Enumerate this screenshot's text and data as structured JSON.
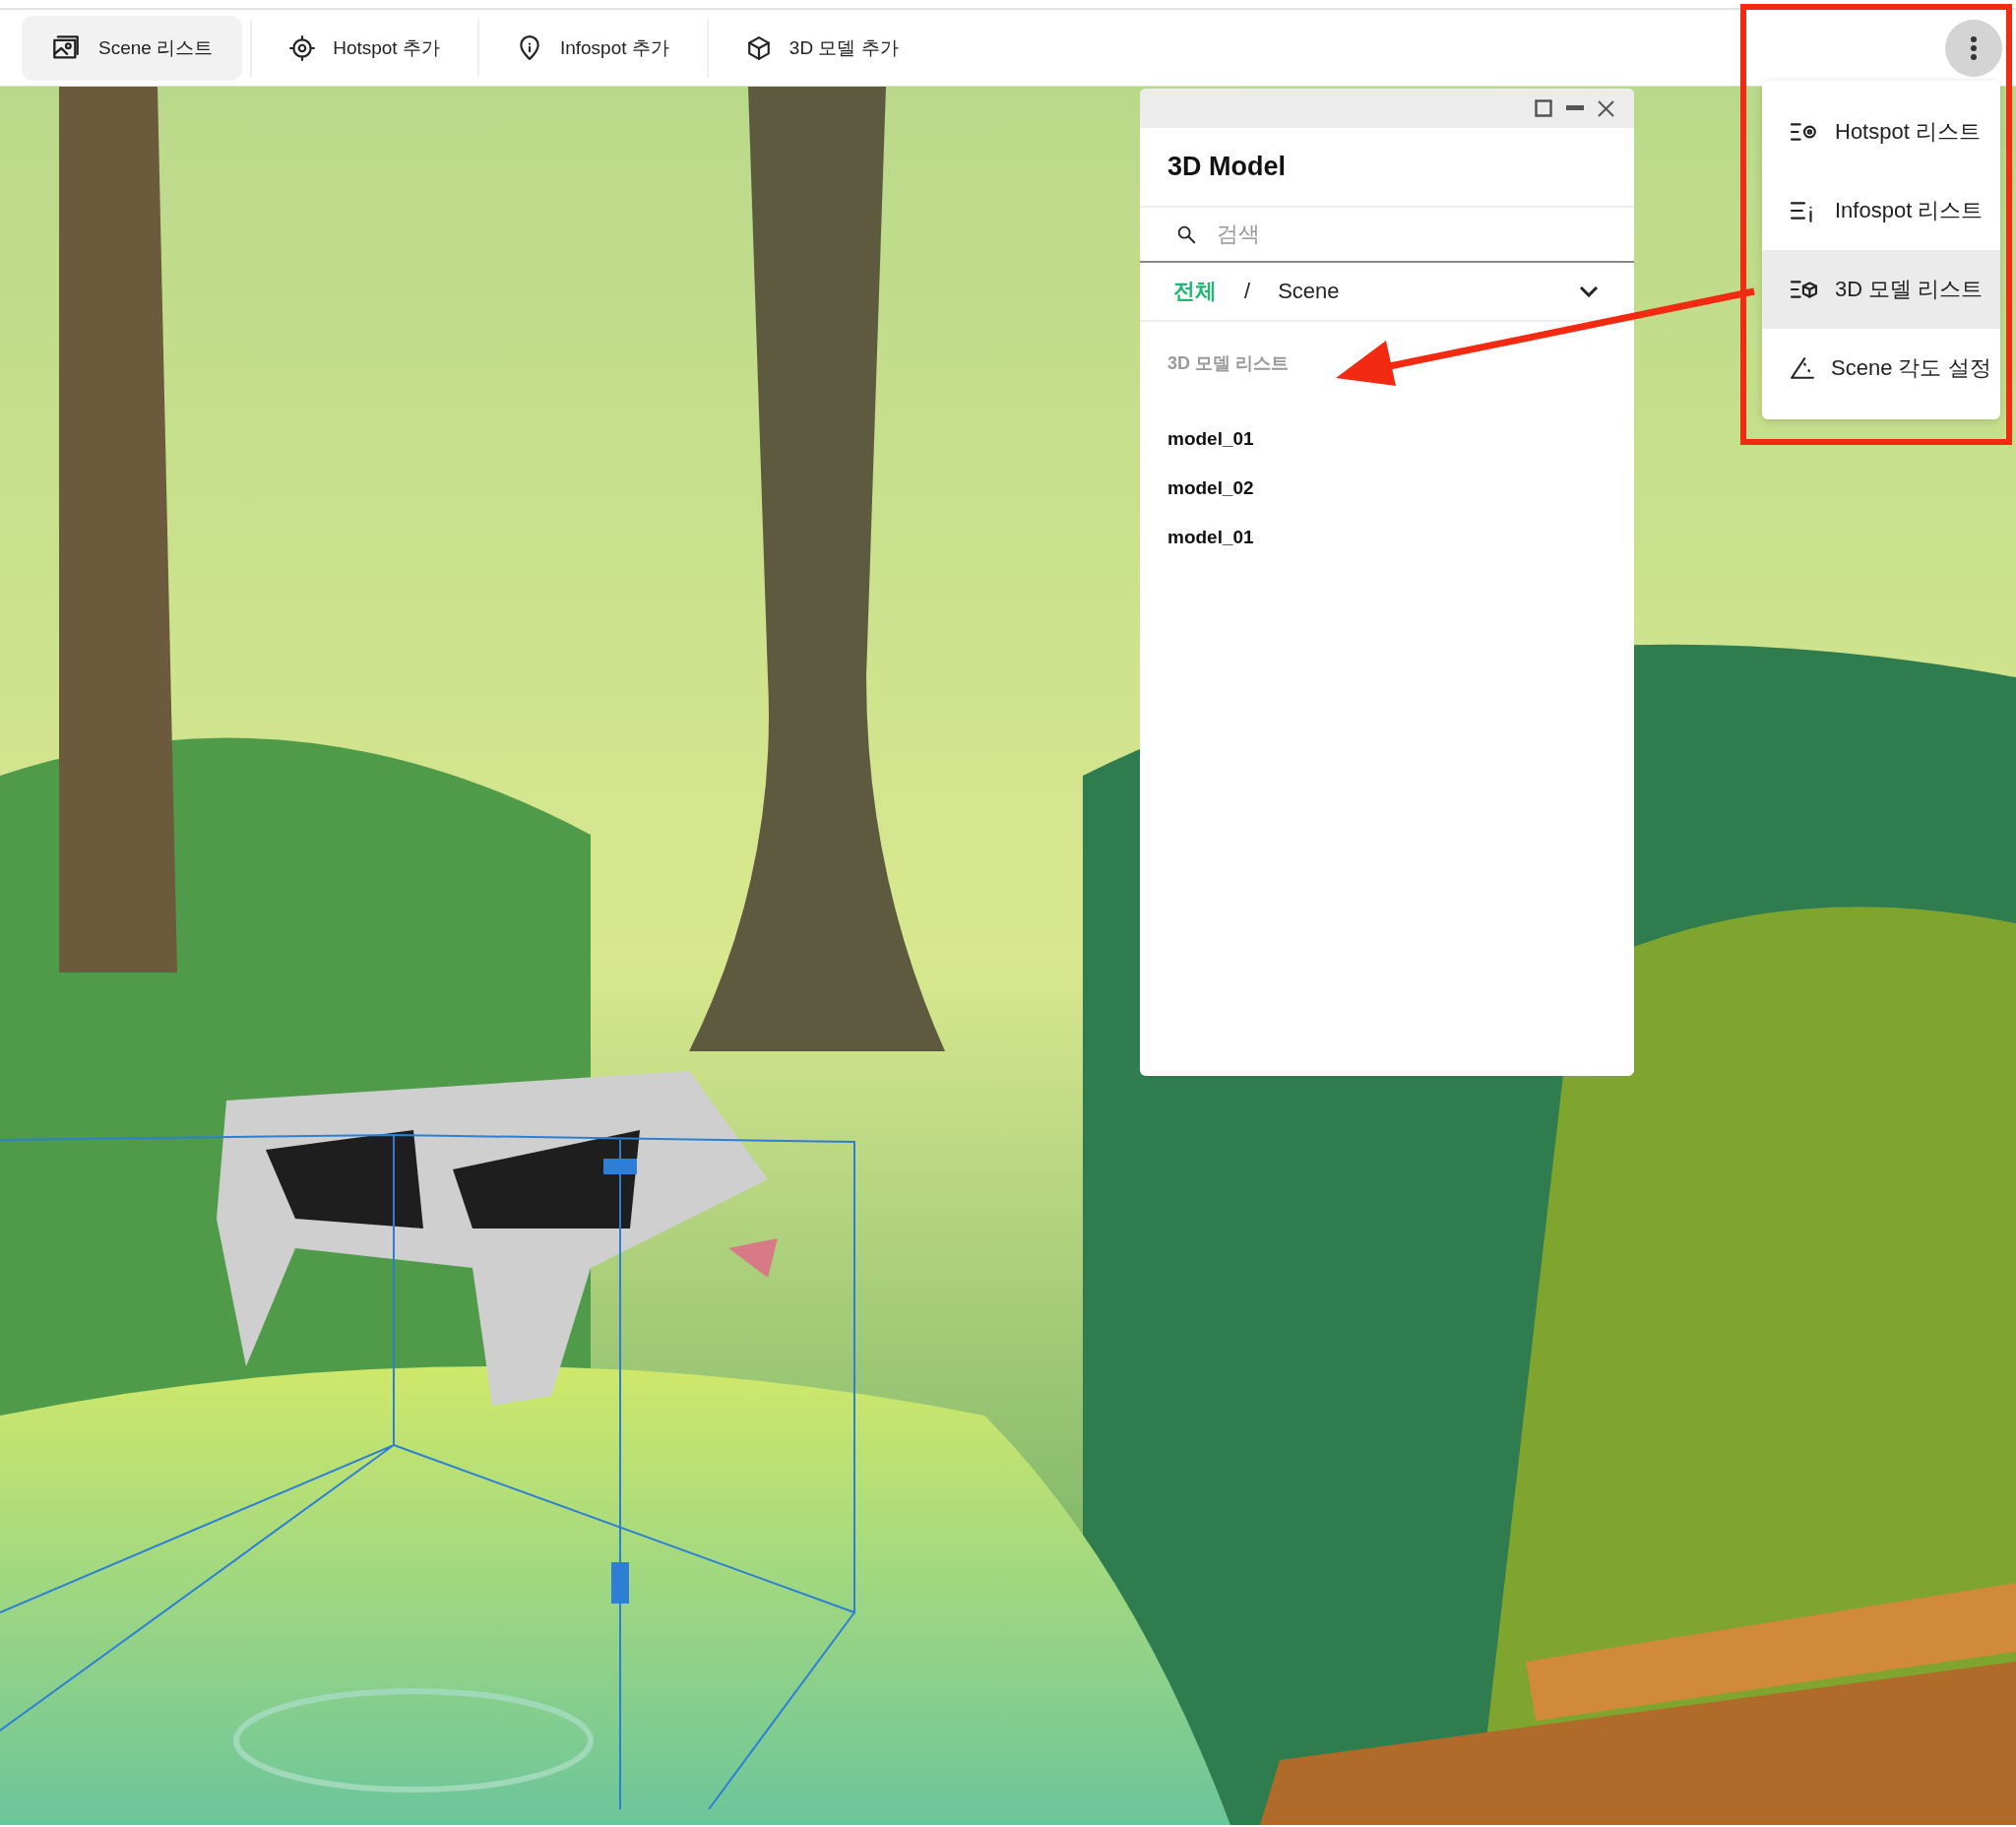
{
  "toolbar": {
    "tabs": [
      {
        "kind": "scene",
        "label": "Scene 리스트",
        "selected": true
      },
      {
        "kind": "hotspot",
        "label": "Hotspot 추가",
        "selected": false
      },
      {
        "kind": "infospot",
        "label": "Infospot 추가",
        "selected": false
      },
      {
        "kind": "model",
        "label": "3D 모델 추가",
        "selected": false
      }
    ]
  },
  "panel": {
    "title": "3D Model",
    "search": {
      "placeholder": "검색"
    },
    "breadcrumb": {
      "separator": "/",
      "items": [
        {
          "label": "전체",
          "selected": true
        },
        {
          "label": "Scene",
          "selected": false
        }
      ]
    },
    "section": "3D 모델 리스트",
    "models": [
      "model_01",
      "model_02",
      "model_01"
    ]
  },
  "menu": {
    "items": [
      {
        "kind": "hotspot",
        "label": "Hotspot 리스트",
        "selected": false
      },
      {
        "kind": "infospot",
        "label": "Infospot 리스트",
        "selected": false
      },
      {
        "kind": "model",
        "label": "3D 모델 리스트",
        "selected": true
      },
      {
        "kind": "angle",
        "label": "Scene 각도 설정",
        "selected": false
      }
    ]
  }
}
